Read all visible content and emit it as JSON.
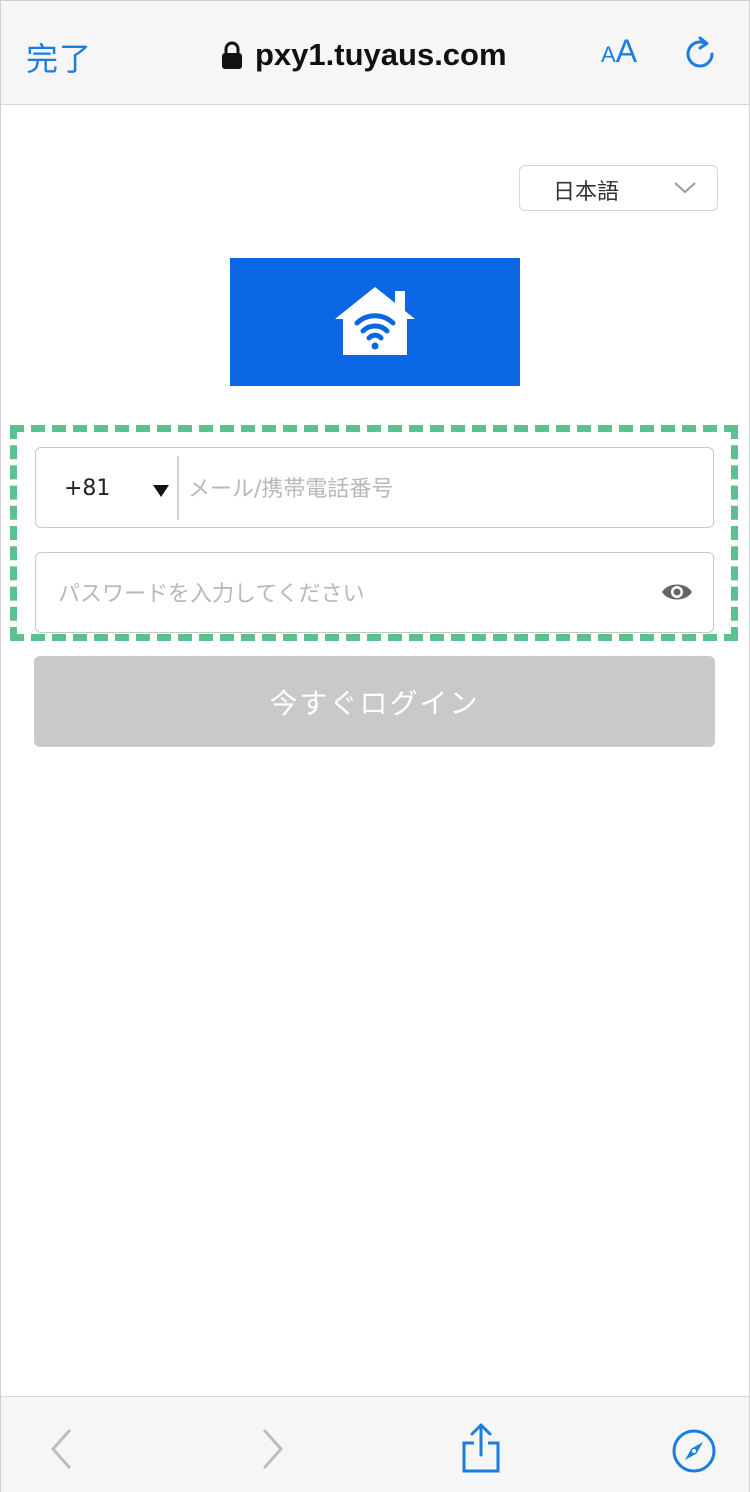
{
  "browser": {
    "done_label": "完了",
    "url": "pxy1.tuyaus.com",
    "text_size_small": "A",
    "text_size_large": "A"
  },
  "language": {
    "selected": "日本語"
  },
  "login": {
    "country_code": "+81",
    "account_placeholder": "メール/携帯電話番号",
    "password_placeholder": "パスワードを入力してください",
    "login_button_label": "今すぐログイン"
  },
  "colors": {
    "accent": "#1a7ee0",
    "logo_bg": "#0b66e4",
    "highlight": "#5cc08f",
    "disabled_button": "#c9c9c9"
  },
  "icons": {
    "lock": "lock-icon",
    "reload": "reload-icon",
    "chevron": "chevron-down-icon",
    "logo": "home-wifi-icon",
    "eye": "eye-icon",
    "back": "back-icon",
    "forward": "forward-icon",
    "share": "share-icon",
    "compass": "compass-icon"
  }
}
